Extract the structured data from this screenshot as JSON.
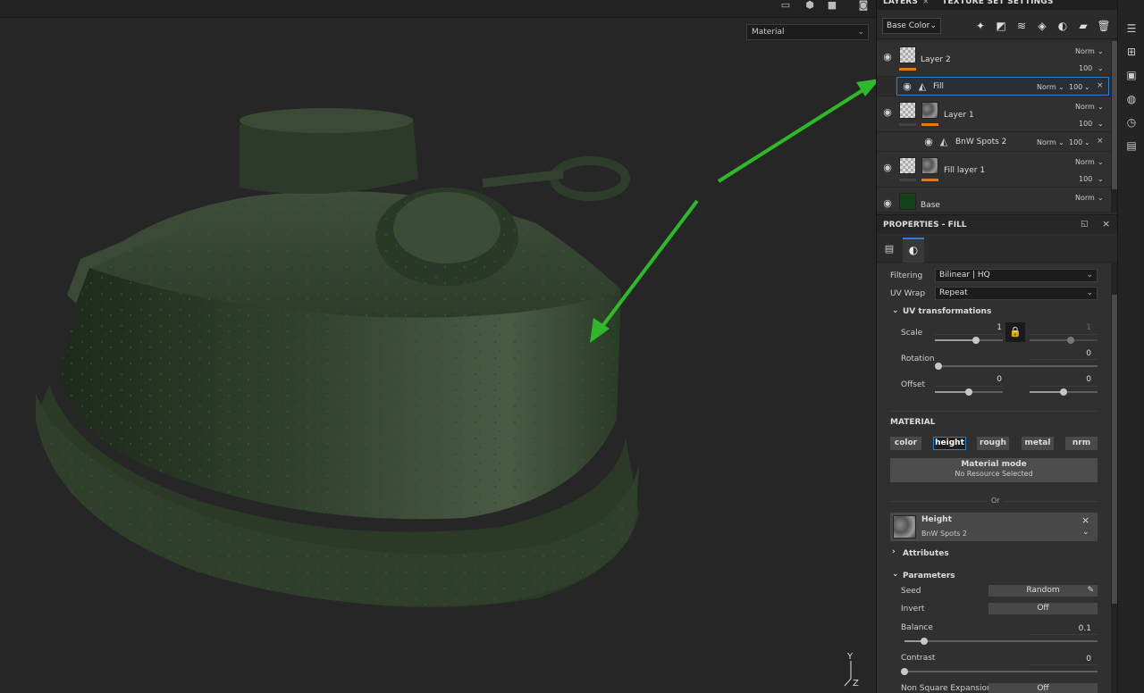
{
  "viewport": {
    "material_mode": "Material",
    "axis": {
      "y": "Y",
      "z": "Z"
    }
  },
  "tabs": {
    "layers": "LAYERS",
    "close": "×",
    "texture_set": "TEXTURE SET SETTINGS"
  },
  "layers_toolbar": {
    "channel": "Base Color"
  },
  "layers": [
    {
      "name": "Layer 2",
      "blend": "Norm",
      "opacity": "100"
    },
    {
      "name": "Fill",
      "blend": "Norm",
      "opacity": "100",
      "x": "×"
    },
    {
      "name": "Layer 1",
      "blend": "Norm",
      "opacity": "100"
    },
    {
      "name": "BnW Spots 2",
      "blend": "Norm",
      "opacity": "100",
      "x": "×"
    },
    {
      "name": "Fill layer 1",
      "blend": "Norm",
      "opacity": "100"
    },
    {
      "name": "Base",
      "blend": "Norm"
    }
  ],
  "properties": {
    "title": "PROPERTIES - FILL",
    "filtering": {
      "label": "Filtering",
      "value": "Bilinear | HQ"
    },
    "uv_wrap": {
      "label": "UV Wrap",
      "value": "Repeat"
    },
    "uv_transformations": "UV transformations",
    "scale": {
      "label": "Scale",
      "value": "1",
      "value2": "1",
      "level": 0.6,
      "level2": 0.6
    },
    "rotation": {
      "label": "Rotation",
      "value": "0",
      "level": 0.0
    },
    "offset": {
      "label": "Offset",
      "value": "0",
      "value2": "0",
      "level": 0.5,
      "level2": 0.5
    },
    "material_section": "MATERIAL",
    "material_buttons": [
      "color",
      "height",
      "rough",
      "metal",
      "nrm"
    ],
    "material_mode": {
      "title": "Material mode",
      "subtitle": "No Resource Selected"
    },
    "or_label": "Or",
    "height_resource": {
      "title": "Height",
      "subtitle": "BnW Spots 2",
      "x": "×"
    },
    "attributes": "Attributes",
    "parameters": "Parameters",
    "seed": {
      "label": "Seed",
      "value": "Random"
    },
    "invert": {
      "label": "Invert",
      "value": "Off"
    },
    "balance": {
      "label": "Balance",
      "value": "0.1",
      "level": 0.1
    },
    "contrast": {
      "label": "Contrast",
      "value": "0",
      "level": 0.0
    },
    "non_square": {
      "label": "Non Square Expansion",
      "value": "Off"
    }
  },
  "colors": {
    "accent": "#2f7fd0",
    "orange": "#e07b1a",
    "arrow": "#2fb82a"
  }
}
